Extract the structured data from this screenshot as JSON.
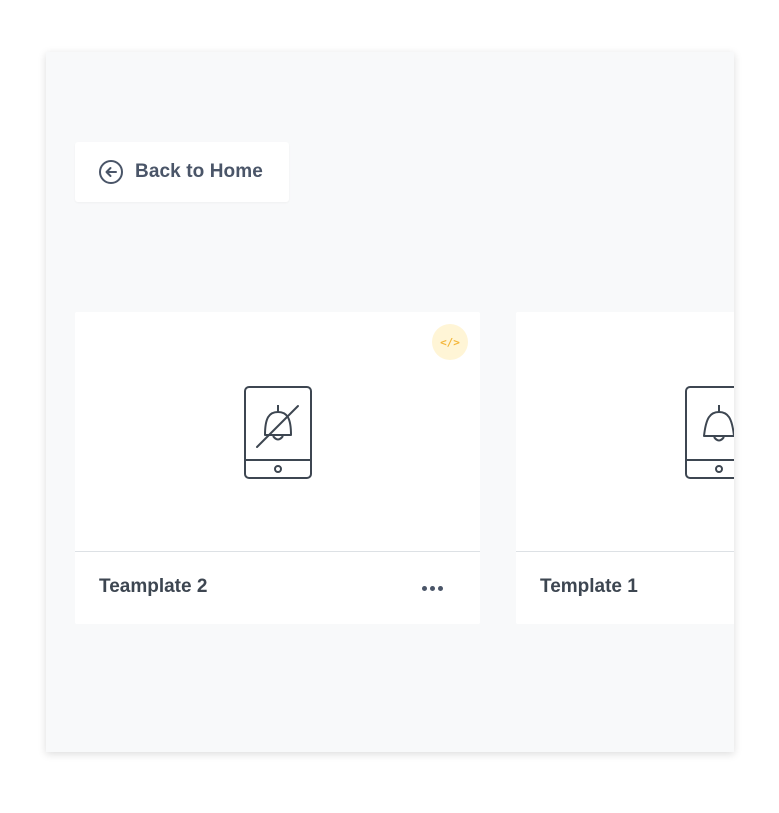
{
  "navigation": {
    "back_label": "Back to Home",
    "back_icon": "arrow-left-circle-icon"
  },
  "templates": [
    {
      "name": "Teamplate 2",
      "preview_icon": "phone-bell-off-icon",
      "badge": "</>",
      "badge_icon": "code-icon",
      "has_menu": true
    },
    {
      "name": "Template 1",
      "preview_icon": "phone-bell-icon",
      "has_menu": true
    }
  ],
  "colors": {
    "background": "#f8f9fa",
    "card": "#ffffff",
    "text": "#3d4651",
    "icon_stroke": "#3d4651",
    "badge_bg": "#fff5d6",
    "badge_fg": "#f4b63a"
  }
}
